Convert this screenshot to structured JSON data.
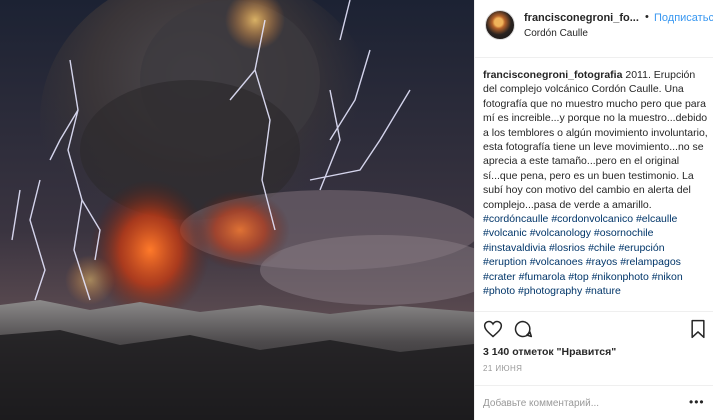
{
  "post": {
    "username": "francisconegroni_fo...",
    "dot": "•",
    "follow_label": "Подписаться",
    "location": "Cordón Caulle"
  },
  "caption": {
    "username": "francisconegroni_fotografia",
    "text": "2011. Erupción del complejo volcánico Cordón Caulle. Una fotografía que no muestro mucho pero que para mí es increible...y porque no la muestro...debido a los temblores o algún movimiento involuntario, esta fotografía tiene un leve movimiento...no se aprecia a este tamaño...pero en el original sí...que pena, pero es un buen testimonio. La subí hoy con motivo del cambio en alerta del complejo...pasa de verde a amarillo.",
    "hashtags": [
      "#cordóncaulle",
      "#cordonvolcanico",
      "#elcaulle",
      "#volcanic",
      "#volcanology",
      "#osornochile",
      "#instavaldivia",
      "#losrios",
      "#chile",
      "#erupción",
      "#eruption",
      "#volcanoes",
      "#rayos",
      "#relampagos",
      "#crater",
      "#fumarola",
      "#top",
      "#nikonphoto",
      "#nikon",
      "#photo",
      "#photography",
      "#nature"
    ]
  },
  "actions": {
    "like_icon": "heart-icon",
    "comment_icon": "comment-icon",
    "save_icon": "bookmark-icon"
  },
  "likes": "3 140 отметок \"Нравится\"",
  "date": "21 ИЮНЯ",
  "comment_field": {
    "placeholder": "Добавьте комментарий...",
    "more_label": "•••"
  }
}
